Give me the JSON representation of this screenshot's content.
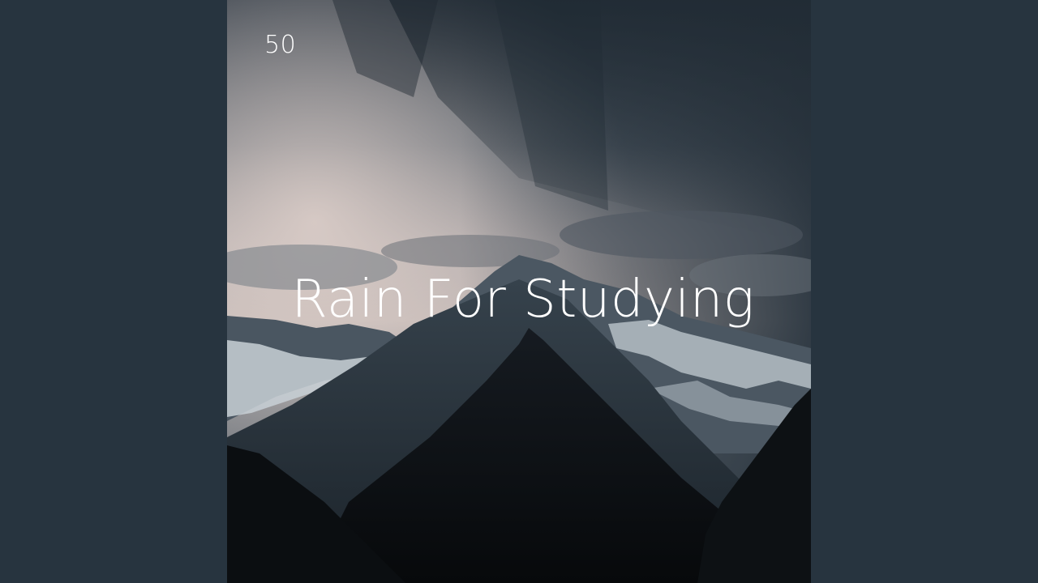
{
  "cover": {
    "number": "50",
    "title": "Rain For Studying",
    "colors": {
      "side_background": "#27343f",
      "sky_top": "#2f3a45",
      "sky_glow": "#d9cbc6",
      "mountain_far": "#3e4a54",
      "snow": "#c9d2d8",
      "peak_dark": "#0c0f13"
    }
  }
}
